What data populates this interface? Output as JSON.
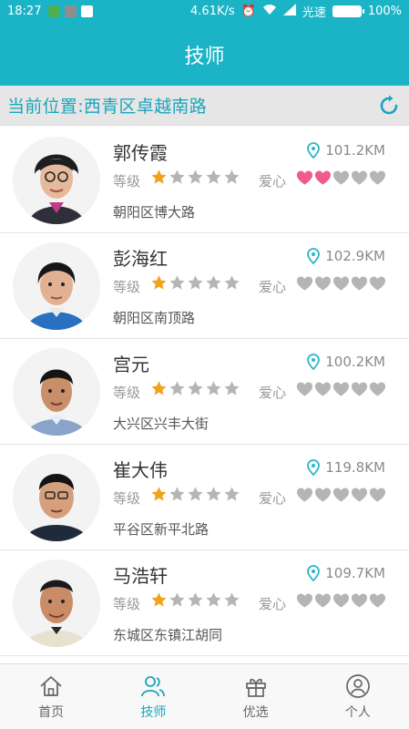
{
  "status_bar": {
    "time": "18:27",
    "speed": "4.61K/s",
    "carrier": "光速",
    "battery": "100%"
  },
  "header": {
    "title": "技师"
  },
  "location_bar": {
    "text": "当前位置:西青区卓越南路"
  },
  "technicians": [
    {
      "name": "郭传霞",
      "distance": "101.2KM",
      "level_label": "等级",
      "level": 1,
      "love_label": "爱心",
      "love": 2,
      "address": "朝阳区博大路"
    },
    {
      "name": "彭海红",
      "distance": "102.9KM",
      "level_label": "等级",
      "level": 1,
      "love_label": "爱心",
      "love": 0,
      "address": "朝阳区南顶路"
    },
    {
      "name": "宫元",
      "distance": "100.2KM",
      "level_label": "等级",
      "level": 1,
      "love_label": "爱心",
      "love": 0,
      "address": "大兴区兴丰大街"
    },
    {
      "name": "崔大伟",
      "distance": "119.8KM",
      "level_label": "等级",
      "level": 1,
      "love_label": "爱心",
      "love": 0,
      "address": "平谷区新平北路"
    },
    {
      "name": "马浩轩",
      "distance": "109.7KM",
      "level_label": "等级",
      "level": 1,
      "love_label": "爱心",
      "love": 0,
      "address": "东城区东镇江胡同"
    }
  ],
  "tabs": [
    {
      "label": "首页",
      "icon": "home-icon"
    },
    {
      "label": "技师",
      "icon": "people-icon",
      "active": true
    },
    {
      "label": "优选",
      "icon": "gift-icon"
    },
    {
      "label": "个人",
      "icon": "person-icon"
    }
  ],
  "colors": {
    "primary": "#1bb4c7",
    "accent_text": "#1aa6bd",
    "star_on": "#f0a21c",
    "star_off": "#b5b5b5",
    "heart_on": "#ef5b8a",
    "heart_off": "#b5b5b5"
  }
}
